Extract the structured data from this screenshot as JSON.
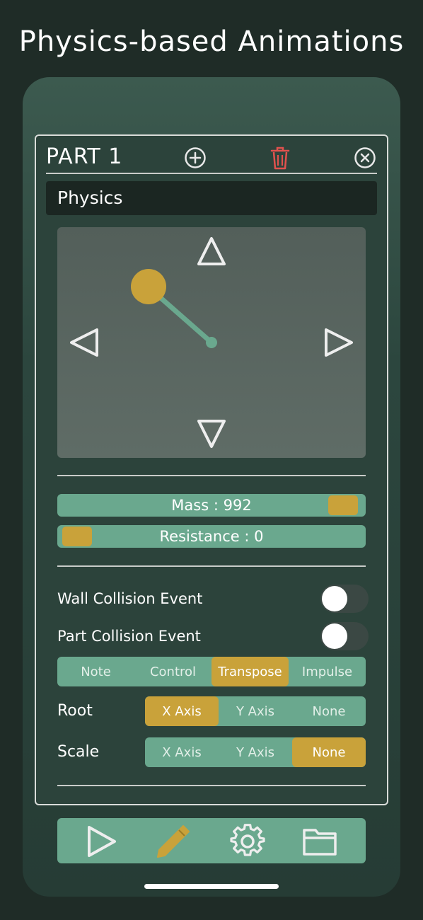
{
  "headline": "Physics-based Animations",
  "panel": {
    "title": "PART 1",
    "add_icon": "plus-circle-icon",
    "delete_icon": "trash-icon",
    "close_icon": "close-circle-icon",
    "section_title": "Physics"
  },
  "pad": {
    "ball_color": "#c9a23a",
    "string_color": "#6aa88e",
    "arrows": [
      "up",
      "left",
      "right",
      "down"
    ]
  },
  "sliders": {
    "mass_label": "Mass : 992",
    "mass_level": 0.99,
    "resistance_label": "Resistance : 0",
    "resistance_level": 0
  },
  "toggles": {
    "wall_collision_label": "Wall Collision Event",
    "wall_collision_on": false,
    "part_collision_label": "Part Collision Event",
    "part_collision_on": false
  },
  "event_mode": {
    "options": [
      "Note",
      "Control",
      "Transpose",
      "Impulse"
    ],
    "selected": "Transpose"
  },
  "root": {
    "label": "Root",
    "options": [
      "X Axis",
      "Y Axis",
      "None"
    ],
    "selected": "X Axis"
  },
  "scale": {
    "label": "Scale",
    "options": [
      "X Axis",
      "Y Axis",
      "None"
    ],
    "selected": "None"
  },
  "toolbar": {
    "items": [
      "play-icon",
      "pencil-icon",
      "gear-icon",
      "folder-icon"
    ]
  },
  "colors": {
    "accent": "#c9a23a",
    "green": "#6aa88e",
    "danger": "#e0524e",
    "background": "#1f2c27"
  }
}
